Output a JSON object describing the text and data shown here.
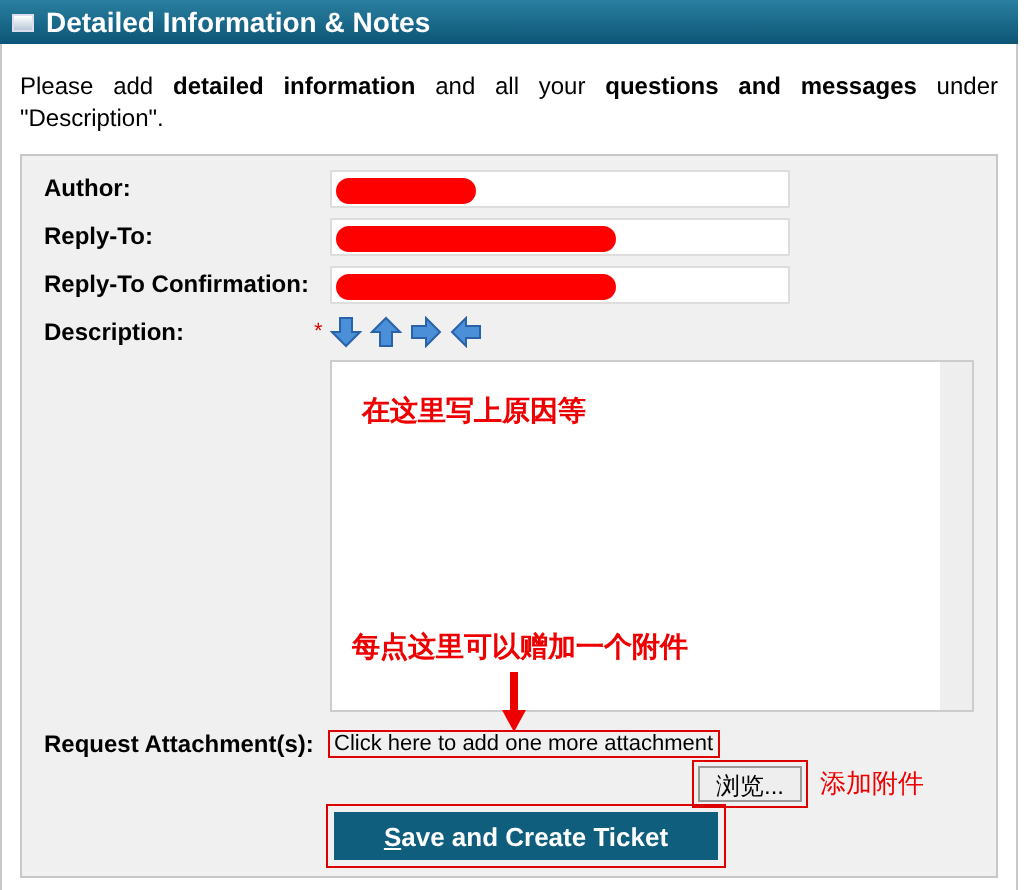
{
  "header": {
    "title": "Detailed Information & Notes"
  },
  "intro": "Please add **detailed information** and all your **questions and messages** under \"Description\".",
  "fields": [
    {
      "label": "Author:",
      "redacted": true
    },
    {
      "label": "Reply-To:",
      "redacted": true
    },
    {
      "label": "Reply-To Confirmation:",
      "redacted": true
    }
  ],
  "description": {
    "label": "Description:",
    "required_mark": "*",
    "note": "在这里写上原因等"
  },
  "attachments": {
    "label": "Request Attachment(s):",
    "link": "Click here to add one more attachment",
    "link_highlighted": true,
    "note": "每点这里可以赠加一个附件",
    "browse": "浏览...",
    "browse_highlighted": true,
    "browse_note": "添加附件"
  },
  "submit": {
    "label": "Save and Create Ticket",
    "access_key_underlined": true,
    "highlighted": true
  }
}
